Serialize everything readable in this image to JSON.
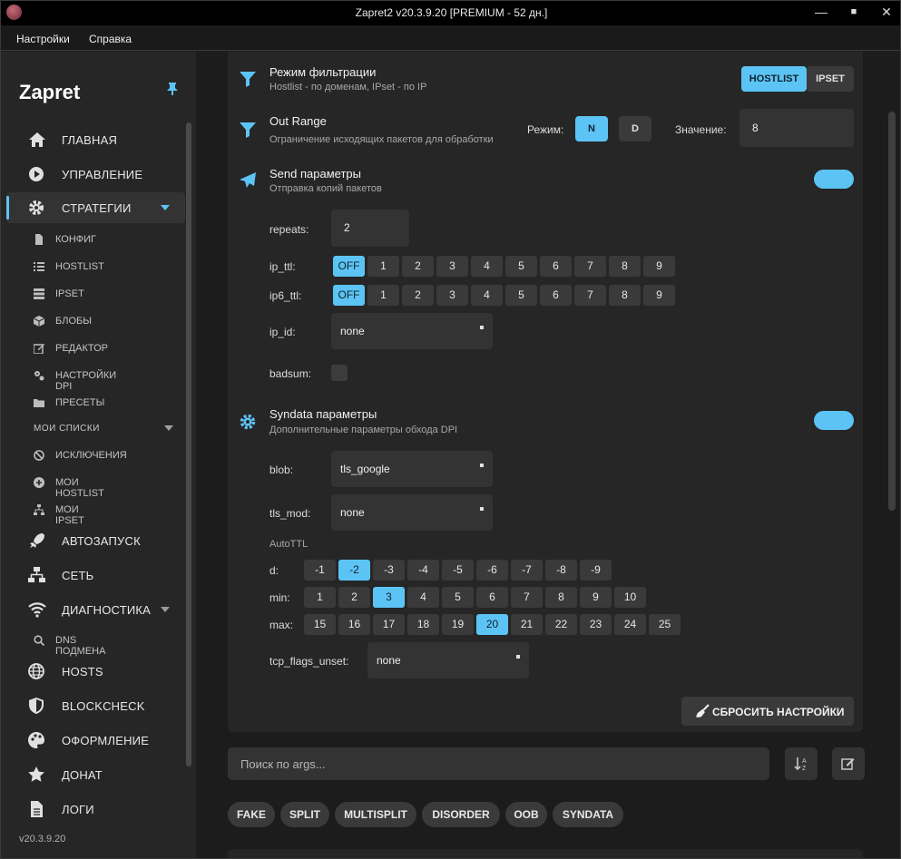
{
  "window": {
    "title": "Zapret2 v20.3.9.20 [PREMIUM - 52 дн.]",
    "minimize": "—",
    "maximize": "■",
    "close": "✕"
  },
  "menu": [
    "Настройки",
    "Справка"
  ],
  "sidebar": {
    "brand": "Zapret",
    "version": "v20.3.9.20",
    "section_label": "МОИ СПИСКИ",
    "items": [
      {
        "label": "ГЛАВНАЯ",
        "icon": "home-icon"
      },
      {
        "label": "УПРАВЛЕНИЕ",
        "icon": "play-icon"
      },
      {
        "label": "СТРАТЕГИИ",
        "icon": "gear-icon"
      },
      {
        "label": "АВТОЗАПУСК",
        "icon": "rocket-icon"
      },
      {
        "label": "СЕТЬ",
        "icon": "network-icon"
      },
      {
        "label": "ДИАГНОСТИКА",
        "icon": "wifi-icon"
      },
      {
        "label": "HOSTS",
        "icon": "globe-icon"
      },
      {
        "label": "BLOCKCHECK",
        "icon": "shield-icon"
      },
      {
        "label": "ОФОРМЛЕНИЕ",
        "icon": "palette-icon"
      },
      {
        "label": "ДОНАТ",
        "icon": "star-icon"
      },
      {
        "label": "ЛОГИ",
        "icon": "document-icon"
      }
    ],
    "subitems": [
      {
        "label": "КОНФИГ",
        "icon": "file-icon"
      },
      {
        "label": "HOSTLIST",
        "icon": "list-icon"
      },
      {
        "label": "IPSET",
        "icon": "server-icon"
      },
      {
        "label": "БЛОБЫ",
        "icon": "cube-icon"
      },
      {
        "label": "РЕДАКТОР",
        "icon": "edit-icon"
      },
      {
        "label": "НАСТРОЙКИ DPI",
        "icon": "cogs-icon"
      },
      {
        "label": "ПРЕСЕТЫ",
        "icon": "folder-icon"
      },
      {
        "label": "ИСКЛЮЧЕНИЯ",
        "icon": "ban-icon"
      },
      {
        "label": "МОИ HOSTLIST",
        "icon": "plus-circle-icon"
      },
      {
        "label": "МОИ IPSET",
        "icon": "sitemap-icon"
      },
      {
        "label": "DNS ПОДМЕНА",
        "icon": "search-icon"
      }
    ]
  },
  "filter": {
    "title": "Режим фильтрации",
    "subtitle": "Hostlist - по доменам, IPset - по IP",
    "options": [
      "HOSTLIST",
      "IPSET"
    ],
    "selected": "HOSTLIST"
  },
  "out_range": {
    "title": "Out Range",
    "subtitle": "Ограничение исходящих пакетов для обработки",
    "mode_label": "Режим:",
    "modes": [
      "N",
      "D"
    ],
    "selected_mode": "N",
    "value_label": "Значение:",
    "value": "8"
  },
  "send": {
    "title": "Send параметры",
    "subtitle": "Отправка копий пакетов",
    "enabled": true,
    "repeats_label": "repeats:",
    "repeats": "2",
    "ip_ttl_label": "ip_ttl:",
    "ip6_ttl_label": "ip6_ttl:",
    "ttl_options": [
      "OFF",
      "1",
      "2",
      "3",
      "4",
      "5",
      "6",
      "7",
      "8",
      "9"
    ],
    "ip_ttl_selected": "OFF",
    "ip6_ttl_selected": "OFF",
    "ip_id_label": "ip_id:",
    "ip_id": "none",
    "badsum_label": "badsum:",
    "badsum": false
  },
  "syndata": {
    "title": "Syndata параметры",
    "subtitle": "Дополнительные параметры обхода DPI",
    "enabled": true,
    "blob_label": "blob:",
    "blob": "tls_google",
    "tls_mod_label": "tls_mod:",
    "tls_mod": "none",
    "autottl_label": "AutoTTL",
    "d_label": "d:",
    "d_options": [
      "-1",
      "-2",
      "-3",
      "-4",
      "-5",
      "-6",
      "-7",
      "-8",
      "-9"
    ],
    "d_selected": "-2",
    "min_label": "min:",
    "min_options": [
      "1",
      "2",
      "3",
      "4",
      "5",
      "6",
      "7",
      "8",
      "9",
      "10"
    ],
    "min_selected": "3",
    "max_label": "max:",
    "max_options": [
      "15",
      "16",
      "17",
      "18",
      "19",
      "20",
      "21",
      "22",
      "23",
      "24",
      "25"
    ],
    "max_selected": "20",
    "tcp_flags_label": "tcp_flags_unset:",
    "tcp_flags": "none"
  },
  "reset_label": "СБРОСИТЬ НАСТРОЙКИ",
  "search": {
    "placeholder": "Поиск по args..."
  },
  "tags": [
    "FAKE",
    "SPLIT",
    "MULTISPLIT",
    "DISORDER",
    "OOB",
    "SYNDATA"
  ],
  "colors": {
    "accent": "#5cc4f5",
    "panel": "#262626",
    "background": "#1c1c1c",
    "chip": "#3a3a3a"
  }
}
